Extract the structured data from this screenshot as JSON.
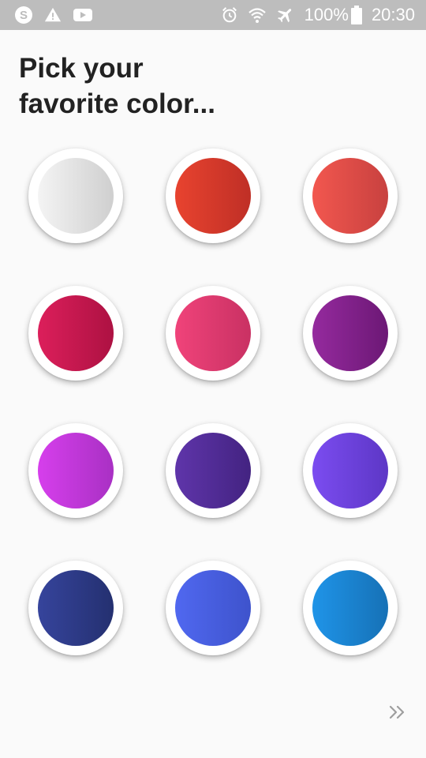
{
  "status_bar": {
    "left_icons": [
      "skype-icon",
      "warning-icon",
      "youtube-icon"
    ],
    "right_icons": [
      "alarm-icon",
      "wifi-icon",
      "airplane-mode-icon",
      "battery-icon"
    ],
    "battery": "100%",
    "time": "20:30"
  },
  "title": {
    "line1": "Pick your",
    "line2": "favorite color..."
  },
  "colors": [
    {
      "name": "white",
      "from": "#f4f4f4",
      "to": "#cfcfcf"
    },
    {
      "name": "red",
      "from": "#e8432f",
      "to": "#bf2f26"
    },
    {
      "name": "coral",
      "from": "#f2574f",
      "to": "#c8413f"
    },
    {
      "name": "crimson",
      "from": "#dc1f5b",
      "to": "#ad1142"
    },
    {
      "name": "pink",
      "from": "#f0437a",
      "to": "#c93163"
    },
    {
      "name": "purple",
      "from": "#952a9e",
      "to": "#6c1875"
    },
    {
      "name": "magenta",
      "from": "#d63fec",
      "to": "#a930c4"
    },
    {
      "name": "deep-purple",
      "from": "#5f35aa",
      "to": "#432381"
    },
    {
      "name": "violet",
      "from": "#7b4cf0",
      "to": "#5d37c6"
    },
    {
      "name": "indigo",
      "from": "#36449c",
      "to": "#243070"
    },
    {
      "name": "blue",
      "from": "#5068f0",
      "to": "#3e53cc"
    },
    {
      "name": "sky-blue",
      "from": "#1f94e8",
      "to": "#1671b6"
    }
  ],
  "next_icon": "double-chevron-right-icon",
  "accent_color": "#9e9e9e"
}
